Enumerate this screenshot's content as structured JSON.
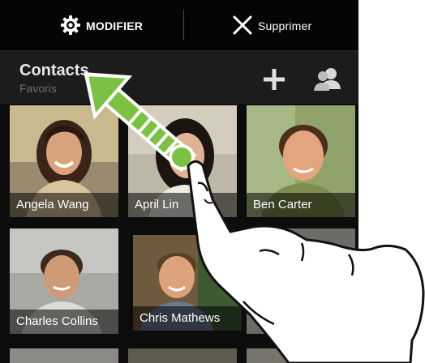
{
  "action_bar": {
    "modifier_label": "MODIFIER",
    "supprimer_label": "Supprimer"
  },
  "header": {
    "title": "Contacts",
    "subtitle": "Favoris"
  },
  "contacts": [
    {
      "name": "Angela Wang"
    },
    {
      "name": "April Lin"
    },
    {
      "name": "Ben Carter"
    },
    {
      "name": "Charles Collins"
    },
    {
      "name": "Chris Mathews"
    },
    {
      "name": ""
    }
  ],
  "icons": {
    "modifier": "gear-icon",
    "supprimer": "close-icon",
    "add": "plus-icon",
    "groups": "people-icon"
  },
  "colors": {
    "accent_green": "#7cc242",
    "bar_bg": "#050505"
  }
}
